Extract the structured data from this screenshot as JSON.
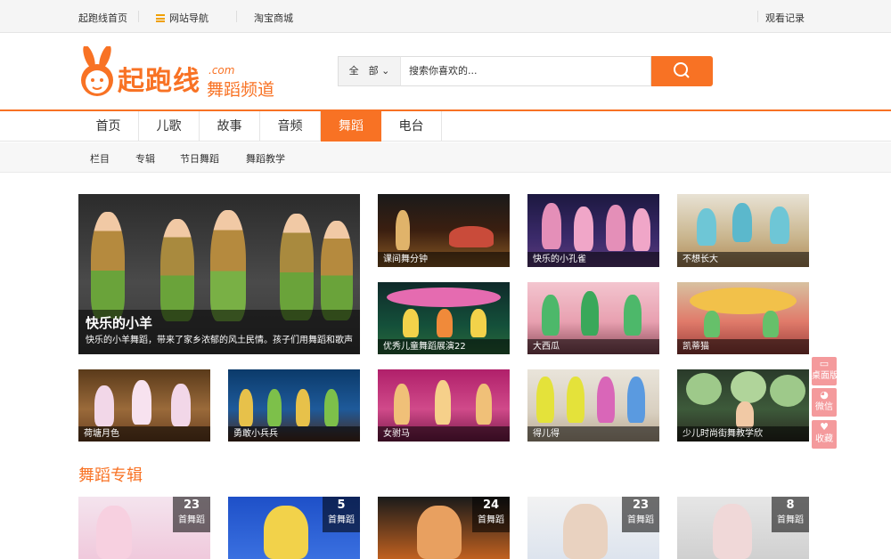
{
  "topbar": {
    "home": "起跑线首页",
    "sitenav": "网站导航",
    "taobao": "淘宝商城",
    "history": "观看记录"
  },
  "logo": {
    "brand": "起跑线",
    "com": ".com",
    "channel": "舞蹈频道"
  },
  "search": {
    "scope": "全　部",
    "placeholder": "搜索你喜欢的..."
  },
  "nav": [
    "首页",
    "儿歌",
    "故事",
    "音频",
    "舞蹈",
    "电台"
  ],
  "nav_active": "舞蹈",
  "subnav": [
    "栏目",
    "专辑",
    "节日舞蹈",
    "舞蹈教学"
  ],
  "featured": {
    "title": "快乐的小羊",
    "desc": "快乐的小羊舞蹈，带来了家乡浓郁的风土民情。孩子们用舞蹈和歌声"
  },
  "tiles": [
    "课间舞分钟",
    "快乐的小孔雀",
    "不想长大",
    "优秀儿童舞蹈展演22",
    "大西瓜",
    "凯蒂猫",
    "荷塘月色",
    "勇敢小兵兵",
    "女驸马",
    "得儿得",
    "少儿时尚街舞教学欣"
  ],
  "section_title": "舞蹈专辑",
  "albums": [
    {
      "count": "23",
      "label": "首舞蹈"
    },
    {
      "count": "5",
      "label": "首舞蹈"
    },
    {
      "count": "24",
      "label": "首舞蹈"
    },
    {
      "count": "23",
      "label": "首舞蹈"
    },
    {
      "count": "8",
      "label": "首舞蹈"
    }
  ],
  "side": {
    "desktop": "桌面版",
    "wechat": "微信",
    "fav": "收藏"
  },
  "colors": {
    "accent": "#f87224",
    "side": "#f49a9c"
  }
}
